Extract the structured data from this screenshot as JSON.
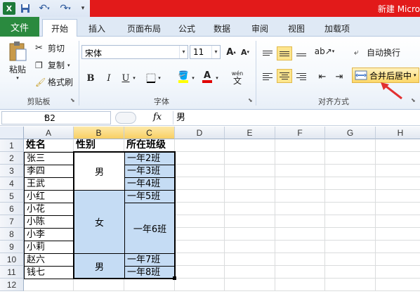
{
  "window": {
    "title": "新建 Micro",
    "qat_more": "▾"
  },
  "tabs": {
    "file": "文件",
    "items": [
      "开始",
      "插入",
      "页面布局",
      "公式",
      "数据",
      "审阅",
      "视图",
      "加载项"
    ],
    "active": 0
  },
  "ribbon": {
    "clipboard": {
      "paste": "粘贴",
      "cut": "剪切",
      "copy": "复制",
      "format_painter": "格式刷",
      "label": "剪贴板"
    },
    "font": {
      "name": "宋体",
      "size": "11",
      "label": "字体",
      "bold": "B",
      "italic": "I",
      "underline": "U",
      "grow": "A",
      "shrink": "A",
      "phonetic": "wén",
      "phonetic_char": "文"
    },
    "alignment": {
      "wrap": "自动换行",
      "merge_center": "合并后居中",
      "label": "对齐方式"
    }
  },
  "formula_bar": {
    "name_box": "B2",
    "fx": "fx",
    "value": "男"
  },
  "grid": {
    "columns": [
      "A",
      "B",
      "C",
      "D",
      "E",
      "F",
      "G",
      "H"
    ],
    "rows": [
      "1",
      "2",
      "3",
      "4",
      "5",
      "6",
      "7",
      "8",
      "9",
      "10",
      "11",
      "12"
    ],
    "header": {
      "a": "姓名",
      "b": "性别",
      "c": "所在班级"
    },
    "names": [
      "张三",
      "李四",
      "王武",
      "小红",
      "小花",
      "小陈",
      "小李",
      "小莉",
      "赵六",
      "钱七"
    ],
    "genders": [
      {
        "value": "男",
        "from": 2,
        "to": 4
      },
      {
        "value": "女",
        "from": 5,
        "to": 9
      },
      {
        "value": "男",
        "from": 10,
        "to": 11
      }
    ],
    "classes": [
      {
        "value": "一年2班",
        "from": 2,
        "to": 2
      },
      {
        "value": "一年3班",
        "from": 3,
        "to": 3
      },
      {
        "value": "一年4班",
        "from": 4,
        "to": 4
      },
      {
        "value": "一年5班",
        "from": 5,
        "to": 5
      },
      {
        "value": "一年6班",
        "from": 6,
        "to": 9
      },
      {
        "value": "一年7班",
        "from": 10,
        "to": 10
      },
      {
        "value": "一年8班",
        "from": 11,
        "to": 11
      }
    ]
  },
  "colors": {
    "accent_green": "#2a8a3f",
    "title_red": "#e21a1a",
    "selection_blue": "#c5dcf4"
  }
}
